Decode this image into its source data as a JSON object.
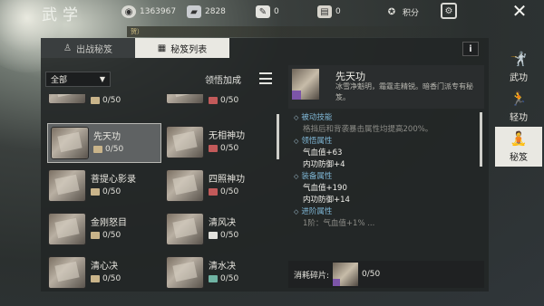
{
  "header": {
    "title": "武学",
    "resources": [
      {
        "icon": "coin-icon",
        "value": "1363967"
      },
      {
        "icon": "silver-ingot-icon",
        "value": "2828"
      },
      {
        "icon": "feather-token-icon",
        "value": "0"
      },
      {
        "icon": "ticket-icon",
        "value": "0"
      },
      {
        "icon": "points-icon",
        "value": "积分"
      }
    ]
  },
  "notice": "贺）",
  "tabs": [
    {
      "label": "出战秘笈",
      "active": false
    },
    {
      "label": "秘笈列表",
      "active": true
    }
  ],
  "filter": {
    "selected": "全部"
  },
  "bonus_label": "领悟加成",
  "list": {
    "items": [
      {
        "name": "",
        "count": "0/50"
      },
      {
        "name": "",
        "count": "0/50"
      },
      {
        "name": "先天功",
        "count": "0/50",
        "selected": true
      },
      {
        "name": "无相神功",
        "count": "0/50"
      },
      {
        "name": "菩提心影录",
        "count": "0/50"
      },
      {
        "name": "四照神功",
        "count": "0/50"
      },
      {
        "name": "金刚怒目",
        "count": "0/50"
      },
      {
        "name": "清风决",
        "count": "0/50"
      },
      {
        "name": "清心决",
        "count": "0/50"
      },
      {
        "name": "清水决",
        "count": "0/50"
      }
    ]
  },
  "detail": {
    "name": "先天功",
    "description": "冰雪净魁明，霜霆走精锐。暗香门派专有秘笈。",
    "sections": [
      {
        "title": "被动技能",
        "lines": [
          "格挡后和背袭暴击属性均提高200%。"
        ],
        "dim": true
      },
      {
        "title": "领悟属性",
        "lines": [
          "气血值+63",
          "内功防御+4"
        ]
      },
      {
        "title": "装备属性",
        "lines": [
          "气血值+190",
          "内功防御+14"
        ]
      },
      {
        "title": "进阶属性",
        "lines": [
          "1阶：气血值+1% ..."
        ],
        "dim": true
      }
    ],
    "cost_label": "消耗碎片:",
    "cost_count": "0/50"
  },
  "side_nav": [
    {
      "label": "武功",
      "icon": "martial-arts-icon",
      "active": false
    },
    {
      "label": "轻功",
      "icon": "lightness-skill-icon",
      "active": false
    },
    {
      "label": "秘笈",
      "icon": "meditation-icon",
      "active": true
    }
  ],
  "colors": {
    "accent_blue": "#7fb7d6",
    "panel_bg": "#222526",
    "active_tab": "#e9e8e2",
    "gem_purple": "#7c55a8"
  }
}
